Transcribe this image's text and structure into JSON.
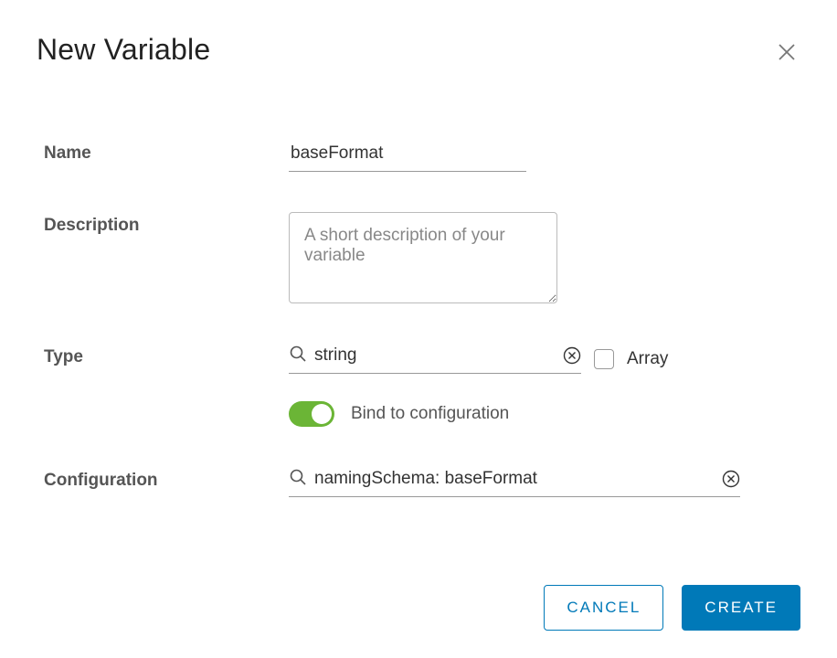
{
  "dialog": {
    "title": "New Variable",
    "close_label": "Close"
  },
  "form": {
    "name": {
      "label": "Name",
      "value": "baseFormat"
    },
    "description": {
      "label": "Description",
      "placeholder": "A short description of your variable",
      "value": ""
    },
    "type": {
      "label": "Type",
      "value": "string",
      "array_label": "Array",
      "array_checked": false
    },
    "bind": {
      "label": "Bind to configuration",
      "enabled": true
    },
    "configuration": {
      "label": "Configuration",
      "value": "namingSchema: baseFormat"
    }
  },
  "actions": {
    "cancel": "CANCEL",
    "create": "CREATE"
  },
  "colors": {
    "primary": "#0079b8",
    "toggle_on": "#6bb536"
  }
}
